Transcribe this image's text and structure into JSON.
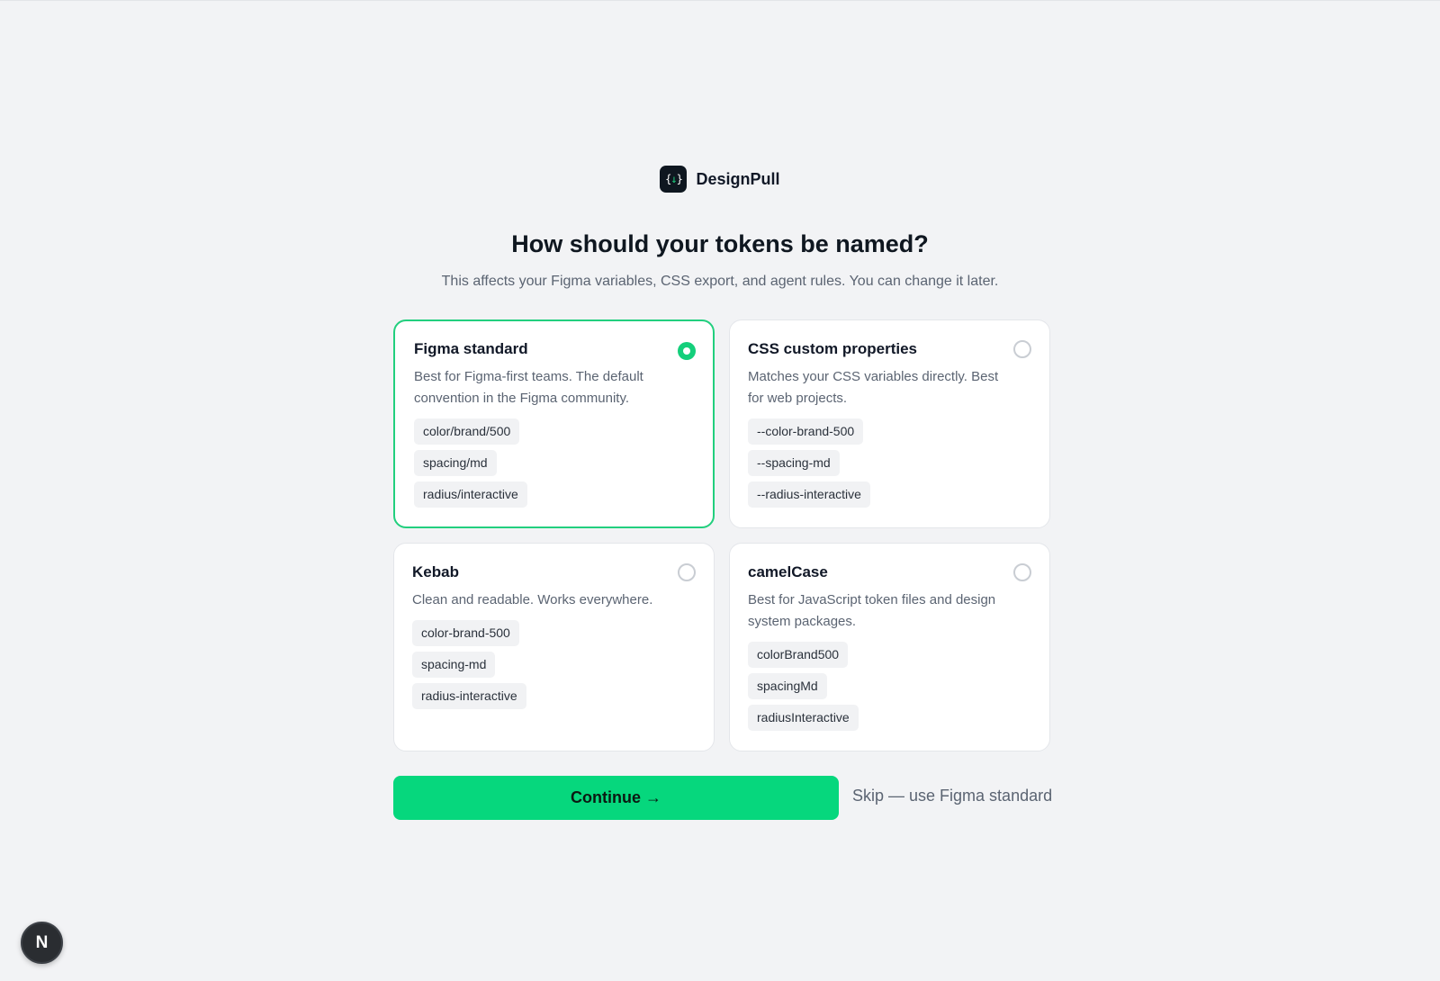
{
  "brand": {
    "logo_glyph_left": "{",
    "logo_glyph_arrow": "↓",
    "logo_glyph_right": "}",
    "name": "DesignPull"
  },
  "header": {
    "title": "How should your tokens be named?",
    "subtitle": "This affects your Figma variables, CSS export, and agent rules. You can change it later."
  },
  "options": [
    {
      "title": "Figma standard",
      "description": "Best for Figma-first teams. The default convention in the Figma community.",
      "selected": true,
      "examples": [
        "color/brand/500",
        "spacing/md",
        "radius/interactive"
      ]
    },
    {
      "title": "CSS custom properties",
      "description": "Matches your CSS variables directly. Best for web projects.",
      "selected": false,
      "examples": [
        "--color-brand-500",
        "--spacing-md",
        "--radius-interactive"
      ]
    },
    {
      "title": "Kebab",
      "description": "Clean and readable. Works everywhere.",
      "selected": false,
      "examples": [
        "color-brand-500",
        "spacing-md",
        "radius-interactive"
      ]
    },
    {
      "title": "camelCase",
      "description": "Best for JavaScript token files and design system packages.",
      "selected": false,
      "examples": [
        "colorBrand500",
        "spacingMd",
        "radiusInteractive"
      ]
    }
  ],
  "actions": {
    "continue_label": "Continue →",
    "skip_label": "Skip — use Figma standard"
  },
  "dev_badge": {
    "letter": "N"
  },
  "colors": {
    "accent": "#06d77d",
    "selected_border": "#22cf7e",
    "background": "#f2f3f5"
  }
}
